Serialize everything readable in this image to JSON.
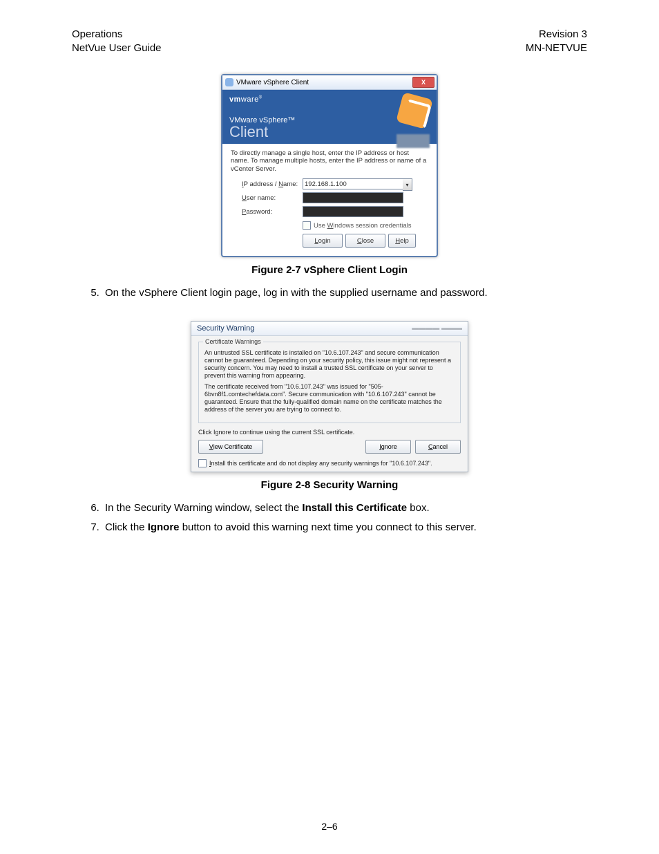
{
  "header": {
    "left1": "Operations",
    "left2": "NetVue User Guide",
    "right1": "Revision 3",
    "right2": "MN-NETVUE"
  },
  "vsphere": {
    "title": "VMware vSphere Client",
    "logo_bold": "vm",
    "logo_rest": "ware",
    "product_line1": "VMware vSphere™",
    "product_line2": "Client",
    "instruction": "To directly manage a single host, enter the IP address or host name. To manage multiple hosts, enter the IP address or name of a vCenter Server.",
    "ip_label": "IP address / Name:",
    "ip_value": "192.168.1.100",
    "user_label": "User name:",
    "pass_label": "Password:",
    "use_win": "Use Windows session credentials",
    "btn_login": "Login",
    "btn_close": "Close",
    "btn_help": "Help"
  },
  "caption1": "Figure 2-7 vSphere Client Login",
  "step5": "On the vSphere Client login page, log in with the supplied username and password.",
  "security": {
    "title": "Security Warning",
    "legend": "Certificate Warnings",
    "para1": "An untrusted SSL certificate is installed on \"10.6.107.243\" and secure communication cannot be guaranteed. Depending on your security policy, this issue might not represent a security concern. You may need to install a trusted SSL certificate on your server to prevent this warning from appearing.",
    "para2": "The certificate received from \"10.6.107.243\" was issued for \"505-6bvn8f1.comtechefdata.com\". Secure communication with \"10.6.107.243\" cannot be guaranteed. Ensure that the fully-qualified domain name on the certificate matches the address of the server you are trying to connect to.",
    "click_ignore": "Click Ignore to continue using the current SSL certificate.",
    "view_cert": "View Certificate",
    "ignore": "Ignore",
    "cancel": "Cancel",
    "install_pre": "nstall this certificate and do not display any security warnings for \"10.6.107.243\"."
  },
  "caption2": "Figure 2-8 Security Warning",
  "step6_pre": "In the Security Warning window, select the ",
  "step6_bold": "Install this Certificate",
  "step6_post": " box.",
  "step7_pre": "Click the ",
  "step7_bold": "Ignore",
  "step7_post": " button to avoid this warning next time you connect to this server.",
  "page_num": "2–6"
}
